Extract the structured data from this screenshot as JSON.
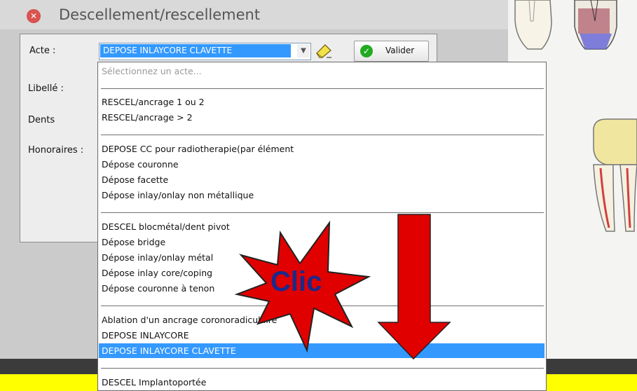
{
  "window": {
    "title": "Descellement/rescellement",
    "close_icon": "close-icon"
  },
  "form": {
    "acte_label": "Acte :",
    "libelle_label": "Libellé :",
    "dents_label": "Dents",
    "honoraires_label": "Honoraires :",
    "acte_value": "DEPOSE INLAYCORE CLAVETTE",
    "validate_label": "Valider"
  },
  "dropdown": {
    "placeholder": "Sélectionnez un acte...",
    "groups": [
      [
        "RESCEL/ancrage 1 ou 2",
        "RESCEL/ancrage > 2"
      ],
      [
        "DEPOSE CC pour radiotherapie(par élément",
        "Dépose couronne",
        "Dépose facette",
        "Dépose inlay/onlay non métallique"
      ],
      [
        "DESCEL blocmétal/dent pivot",
        "Dépose bridge",
        "Dépose inlay/onlay métal",
        "Dépose inlay core/coping",
        "Dépose couronne à tenon"
      ],
      [
        "Ablation d'un ancrage coronoradiculaire",
        "DEPOSE INLAYCORE",
        "DEPOSE INLAYCORE CLAVETTE"
      ],
      [
        "DESCEL Implantoportée"
      ]
    ],
    "selected": "DEPOSE INLAYCORE CLAVETTE"
  },
  "annotation": {
    "text": "Clic",
    "star_color": "#e00000",
    "arrow_color": "#e00000"
  }
}
